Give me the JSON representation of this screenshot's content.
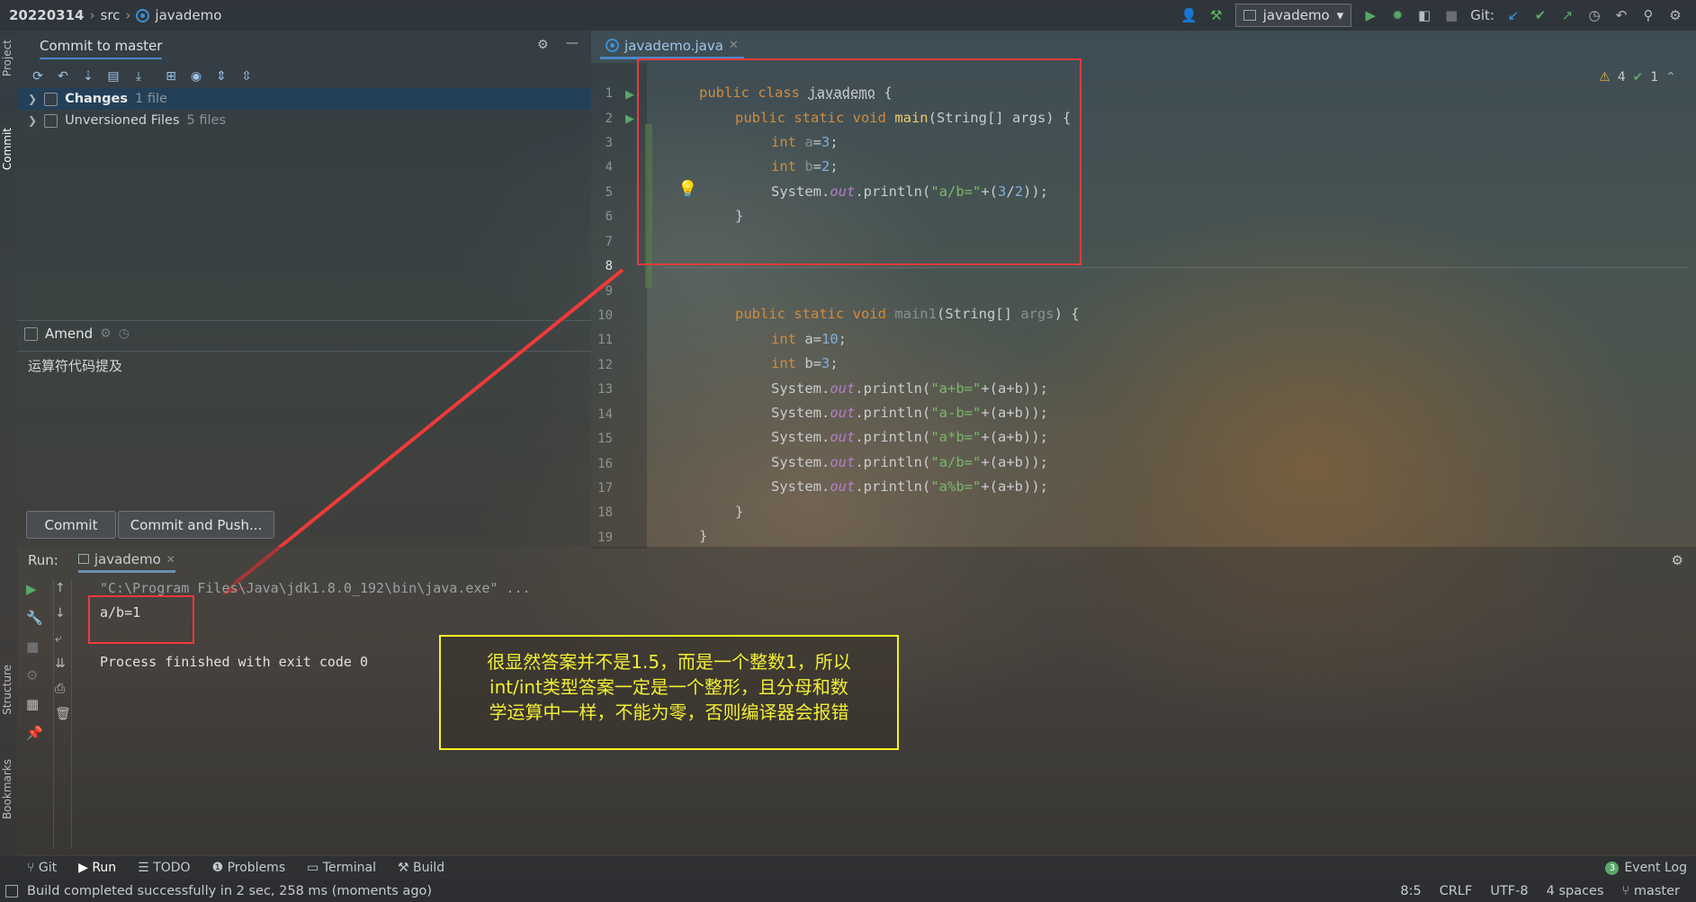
{
  "breadcrumb": {
    "project": "20220314",
    "folder": "src",
    "file": "javademo"
  },
  "toolbar": {
    "run_config": "javademo",
    "git_label": "Git:"
  },
  "left_stripe": {
    "project": "Project",
    "commit": "Commit",
    "structure": "Structure",
    "bookmarks": "Bookmarks"
  },
  "commit_panel": {
    "title": "Commit to master",
    "changes_label": "Changes",
    "changes_count": "1 file",
    "unversioned_label": "Unversioned Files",
    "unversioned_count": "5 files",
    "amend_label": "Amend",
    "message": "运算符代码提及",
    "commit_button": "Commit",
    "commit_push_button": "Commit and Push..."
  },
  "editor": {
    "tab": "javademo.java",
    "warnings": "4",
    "checks": "1",
    "line_numbers": [
      "1",
      "2",
      "3",
      "4",
      "5",
      "6",
      "7",
      "8",
      "9",
      "10",
      "11",
      "12",
      "13",
      "14",
      "15",
      "16",
      "17",
      "18",
      "19"
    ]
  },
  "run_panel": {
    "label": "Run:",
    "tab": "javademo",
    "cmd_line": "\"C:\\Program Files\\Java\\jdk1.8.0_192\\bin\\java.exe\" ...",
    "output_line": "a/b=1",
    "finish_line": "Process finished with exit code 0"
  },
  "annotation": {
    "line1": "很显然答案并不是1.5，而是一个整数1，所以",
    "line2": "int/int类型答案一定是一个整形，且分母和数",
    "line3": "学运算中一样，不能为零，否则编译器会报错"
  },
  "bottom_tabs": [
    "Git",
    "Run",
    "TODO",
    "Problems",
    "Terminal",
    "Build"
  ],
  "event_log": {
    "count": "3",
    "label": "Event Log"
  },
  "status": {
    "message": "Build completed successfully in 2 sec, 258 ms (moments ago)",
    "position": "8:5",
    "line_sep": "CRLF",
    "encoding": "UTF-8",
    "indent": "4 spaces",
    "branch": "master"
  }
}
